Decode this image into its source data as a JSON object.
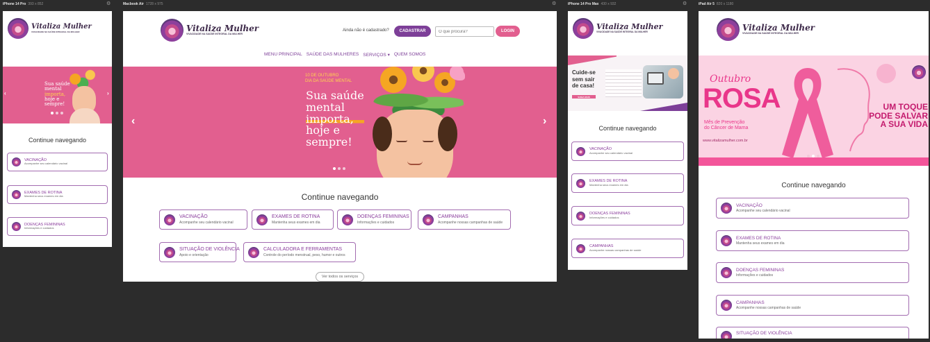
{
  "frames": {
    "iphone14pro": {
      "name": "iPhone 14 Pro",
      "size": "393 x 852"
    },
    "macbook": {
      "name": "Macbook Air",
      "size": "1728 x 975"
    },
    "iphone14promax": {
      "name": "iPhone 14 Pro Max",
      "size": "430 x 932"
    },
    "ipad": {
      "name": "iPad Air 5",
      "size": "820 x 1180"
    }
  },
  "brand": {
    "name": "Vitaliza Mulher",
    "tagline": "VIVACIDADE NA SAÚDE INTEGRAL DA MULHER",
    "colors": {
      "pink": "#e25f8f",
      "purple": "#7d3f98",
      "card_border": "#a26bb0"
    }
  },
  "header": {
    "not_registered": "Ainda não é cadastrado?",
    "register_label": "CADASTRAR",
    "search_placeholder": "O que procura?",
    "login_label": "LOGIN"
  },
  "nav": {
    "items": [
      "MENU PRINCIPAL",
      "SAÚDE DAS MULHERES",
      "SERVIÇOS",
      "QUEM SOMOS"
    ]
  },
  "banner_mental": {
    "date_line1": "10 DE OUTUBRO",
    "date_line2": "DIA DA SAÚDE MENTAL",
    "headline1": "Sua saúde",
    "headline2": "mental",
    "headline3": "importa,",
    "headline4": "hoje e",
    "headline5": "sempre!"
  },
  "banner_care": {
    "headline1": "Cuide-se",
    "headline2": "sem sair",
    "headline3": "de casa!",
    "cta": "SAIBA MAIS"
  },
  "banner_pink": {
    "script": "Outubro",
    "title": "ROSA",
    "sub1": "Mês de Prevenção",
    "sub2": "do Câncer de Mama",
    "site": "www.vitalizamulher.com.br",
    "slogan1": "UM TOQUE",
    "slogan2": "PODE SALVAR",
    "slogan3": "A SUA VIDA"
  },
  "continue": {
    "title": "Continue navegando",
    "view_all": "Ver todos os serviços",
    "cards": [
      {
        "title": "VACINAÇÃO",
        "desc": "Acompanhe seu calendário vacinal"
      },
      {
        "title": "EXAMES DE ROTINA",
        "desc": "Mantenha seus exames em dia"
      },
      {
        "title": "DOENÇAS FEMININAS",
        "desc": "Informações e cuidados"
      },
      {
        "title": "CAMPANHAS",
        "desc": "Acompanhe nossas campanhas de saúde"
      },
      {
        "title": "SITUAÇÃO DE VIOLÊNCIA",
        "desc": "Apoio e orientação"
      },
      {
        "title": "CALCULADORA E FERRAMENTAS",
        "desc": "Controle do período menstrual, peso, humor e outros"
      }
    ]
  }
}
